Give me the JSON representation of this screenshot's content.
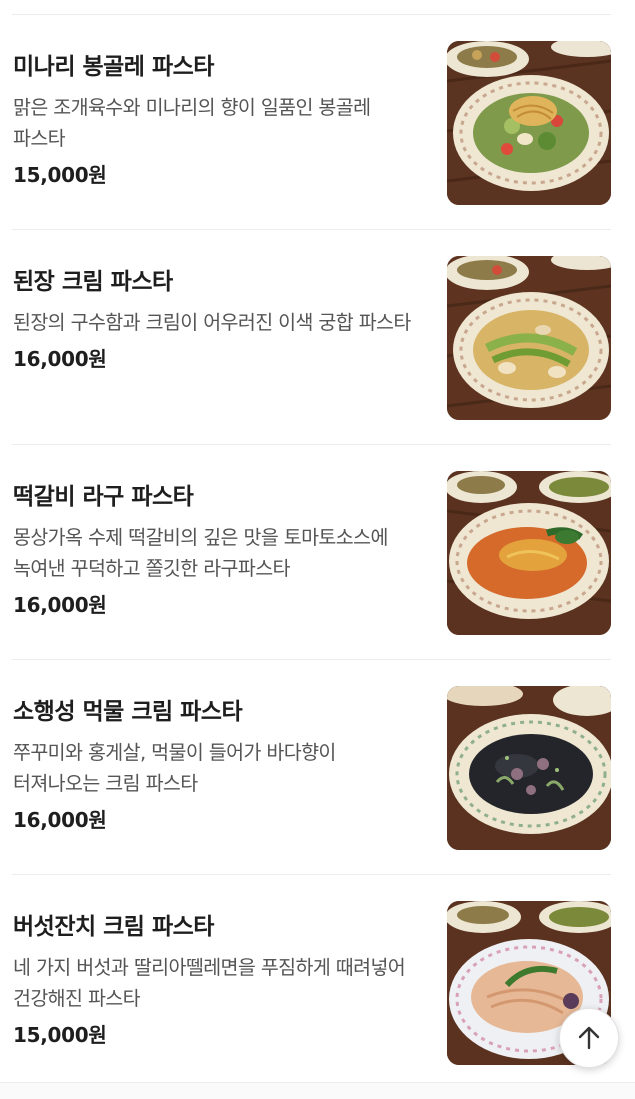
{
  "menu": {
    "items": [
      {
        "name": "미나리 봉골레 파스타",
        "description": "맑은 조개육수와 미나리의 향이 일품인 봉골레 파스타",
        "price": "15,000원",
        "image": "vongole-salad-dish"
      },
      {
        "name": "된장 크림 파스타",
        "description": "된장의 구수함과 크림이 어우러진 이색 궁합 파스타",
        "price": "16,000원",
        "image": "clam-greens-dish"
      },
      {
        "name": "떡갈비 라구 파스타",
        "description": "몽상가옥 수제 떡갈비의 깊은 맛을 토마토소스에 녹여낸 꾸덕하고 쫄깃한 라구파스타",
        "price": "16,000원",
        "image": "ragu-tomato-dish"
      },
      {
        "name": "소행성 먹물 크림 파스타",
        "description": "쭈꾸미와 홍게살, 먹물이 들어가 바다향이 터져나오는 크림 파스타",
        "price": "16,000원",
        "image": "squid-ink-dish"
      },
      {
        "name": "버섯잔치 크림 파스타",
        "description": "네 가지 버섯과 딸리아뗄레면을 푸짐하게 때려넣어 건강해진 파스타",
        "price": "15,000원",
        "image": "mushroom-cream-dish"
      }
    ]
  },
  "scroll_top": {
    "icon": "arrow-up-icon"
  },
  "colors": {
    "text_primary": "#1e1e1e",
    "text_secondary": "#555555",
    "divider": "#ececec",
    "table_wood": "#5a3220"
  }
}
